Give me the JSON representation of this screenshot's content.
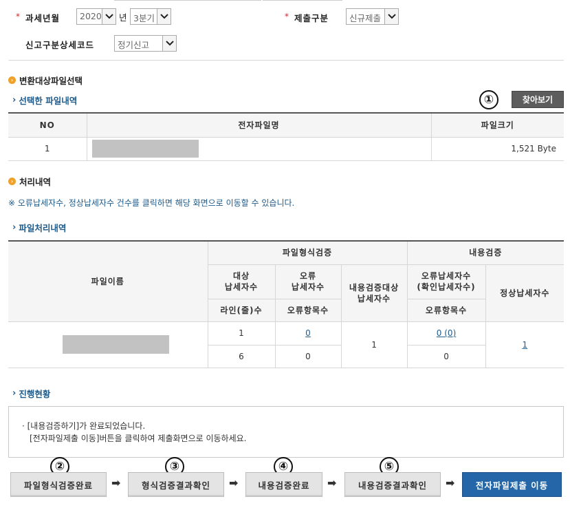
{
  "filters": {
    "tax_period_label": "과세년월",
    "year_value": "2020",
    "year_suffix": "년",
    "quarter_value": "3분기",
    "submit_type_label": "제출구분",
    "submit_type_value": "신규제출",
    "report_detail_label": "신고구분상세코드",
    "report_detail_value": "정기신고",
    "required_mark": "*"
  },
  "file_select": {
    "section_title": "변환대상파일선택",
    "subsection_title": "선택한 파일내역",
    "browse_button": "찾아보기",
    "callout_1": "①",
    "columns": [
      "NO",
      "전자파일명",
      "파일크기"
    ],
    "rows": [
      {
        "no": "1",
        "file_name": "",
        "file_size": "1,521 Byte"
      }
    ]
  },
  "processing": {
    "section_title": "처리내역",
    "notice": "※ 오류납세자수, 정상납세자수 건수를 클릭하면 해당 화면으로 이동할 수 있습니다.",
    "subsection_title": "파일처리내역",
    "headers": {
      "file_name": "파일이름",
      "format_check": "파일형식검증",
      "content_check": "내용검증",
      "target_taxpayers": "대상\n납세자수",
      "error_taxpayers": "오류\n납세자수",
      "content_target": "내용검증대상\n납세자수",
      "content_error": "오류납세자수\n(확인납세자수)",
      "normal_taxpayers": "정상납세자수",
      "lines": "라인(줄)수",
      "error_items": "오류항목수",
      "content_error_items": "오류항목수"
    },
    "row": {
      "target_taxpayers": "1",
      "error_taxpayers": "0",
      "content_target": "1",
      "content_error": "0 (0)",
      "normal_taxpayers": "1",
      "lines": "6",
      "error_items": "0",
      "content_error_items": "0"
    }
  },
  "progress": {
    "subsection_title": "진행현황",
    "message_line1": "· [내용검증하기]가 완료되었습니다.",
    "message_line2": "[전자파일제출 이동]버튼을 클릭하여 제출화면으로 이동하세요."
  },
  "steps": {
    "step1": "파일형식검증완료",
    "step2": "형식검증결과확인",
    "step3": "내용검증완료",
    "step4": "내용검증결과확인",
    "submit": "전자파일제출 이동",
    "arrow": "➡",
    "callout_2": "②",
    "callout_3": "③",
    "callout_4": "④",
    "callout_5": "⑤"
  }
}
